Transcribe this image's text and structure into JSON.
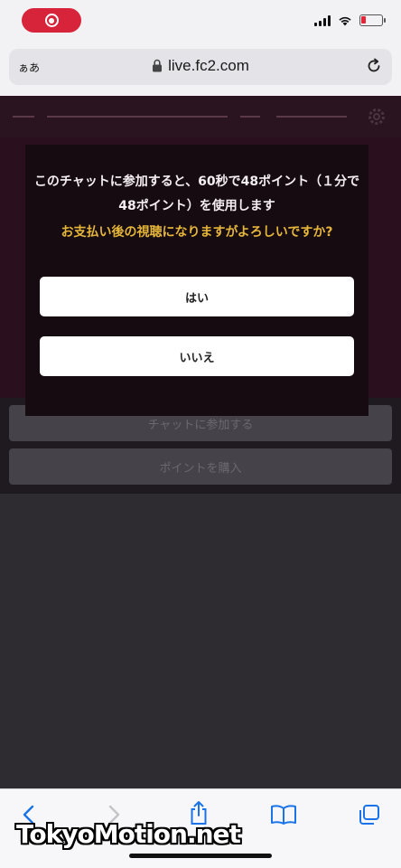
{
  "browser": {
    "text_size_label": "ぁあ",
    "url": "live.fc2.com"
  },
  "dialog": {
    "message": "このチャットに参加すると、60秒で48ポイント（１分で48ポイント）を使用します",
    "warning": "お支払い後の視聴になりますがよろしいですか?",
    "yes_label": "はい",
    "no_label": "いいえ"
  },
  "page": {
    "join_chat_label": "チャットに参加する",
    "buy_points_label": "ポイントを購入"
  },
  "watermark": "TokyoMotion.net",
  "colors": {
    "accent_warning": "#e6b63a",
    "record_indicator": "#d8243a",
    "toolbar_icon": "#1a73e8"
  },
  "icons": {
    "back": "chevron-left-icon",
    "forward": "chevron-right-icon",
    "share": "share-icon",
    "bookmarks": "book-icon",
    "tabs": "tabs-icon",
    "lock": "lock-icon",
    "reload": "reload-icon",
    "settings": "gear-icon"
  }
}
